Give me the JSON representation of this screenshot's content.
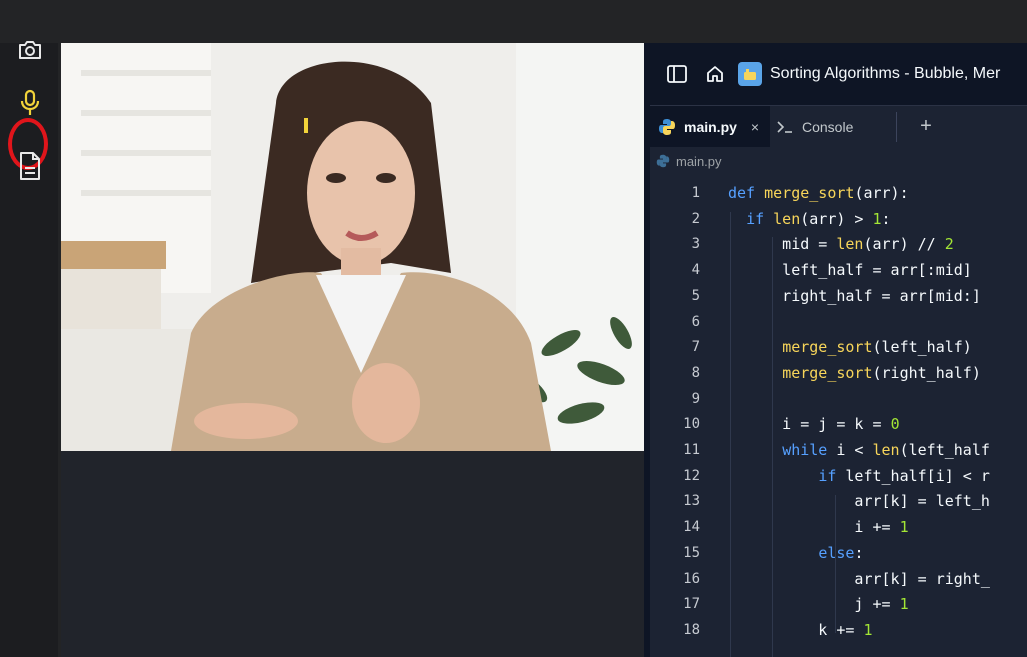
{
  "sidebar": {
    "icons": [
      "camera-icon",
      "microphone-icon",
      "document-icon"
    ],
    "highlight_color": "#e0151b",
    "active_mic_color": "#f2d33a"
  },
  "replit": {
    "repl_title": "Sorting Algorithms - Bubble, Mer",
    "tabs": [
      {
        "label": "main.py",
        "active": true
      },
      {
        "label": "Console",
        "active": false
      }
    ],
    "add_tab_label": "+",
    "close_tab_label": "×",
    "breadcrumb": "main.py",
    "line_numbers": [
      "1",
      "2",
      "3",
      "4",
      "5",
      "6",
      "7",
      "8",
      "9",
      "10",
      "11",
      "12",
      "13",
      "14",
      "15",
      "16",
      "17",
      "18"
    ],
    "code_lines": [
      "def merge_sort(arr):",
      "  if len(arr) > 1:",
      "      mid = len(arr) // 2",
      "      left_half = arr[:mid]",
      "      right_half = arr[mid:]",
      "",
      "      merge_sort(left_half)",
      "      merge_sort(right_half)",
      "",
      "      i = j = k = 0",
      "      while i < len(left_half",
      "          if left_half[i] < r",
      "              arr[k] = left_h",
      "              i += 1",
      "          else:",
      "              arr[k] = right_",
      "              j += 1",
      "          k += 1"
    ]
  },
  "colors": {
    "editor_bg": "#1c2333",
    "keyword": "#56a0ff",
    "function": "#f7d55a",
    "number": "#a3e635"
  }
}
